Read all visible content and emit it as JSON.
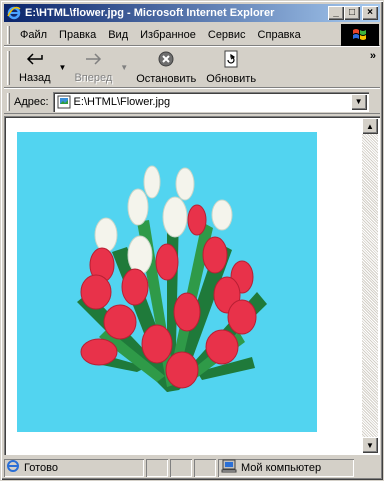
{
  "window": {
    "title": "E:\\HTML\\flower.jpg - Microsoft Internet Explorer",
    "minimize_glyph": "_",
    "maximize_glyph": "□",
    "close_glyph": "×"
  },
  "menu": {
    "items": [
      {
        "label": "Файл",
        "icon": "none"
      },
      {
        "label": "Правка",
        "icon": "none"
      },
      {
        "label": "Вид",
        "icon": "none"
      },
      {
        "label": "Избранное",
        "icon": "none"
      },
      {
        "label": "Сервис",
        "icon": "none"
      },
      {
        "label": "Справка",
        "icon": "none"
      }
    ]
  },
  "toolbar": {
    "back_label": "Назад",
    "forward_label": "Вперед",
    "stop_label": "Остановить",
    "refresh_label": "Обновить",
    "more_glyph": "»"
  },
  "address": {
    "label": "Адрес:",
    "value": "E:\\HTML\\Flower.jpg"
  },
  "status": {
    "text": "Готово",
    "zone": "Мой компьютер"
  },
  "colors": {
    "picture_background": "#52d4f0",
    "titlebar_start": "#0a246a",
    "titlebar_end": "#a6caf0"
  }
}
